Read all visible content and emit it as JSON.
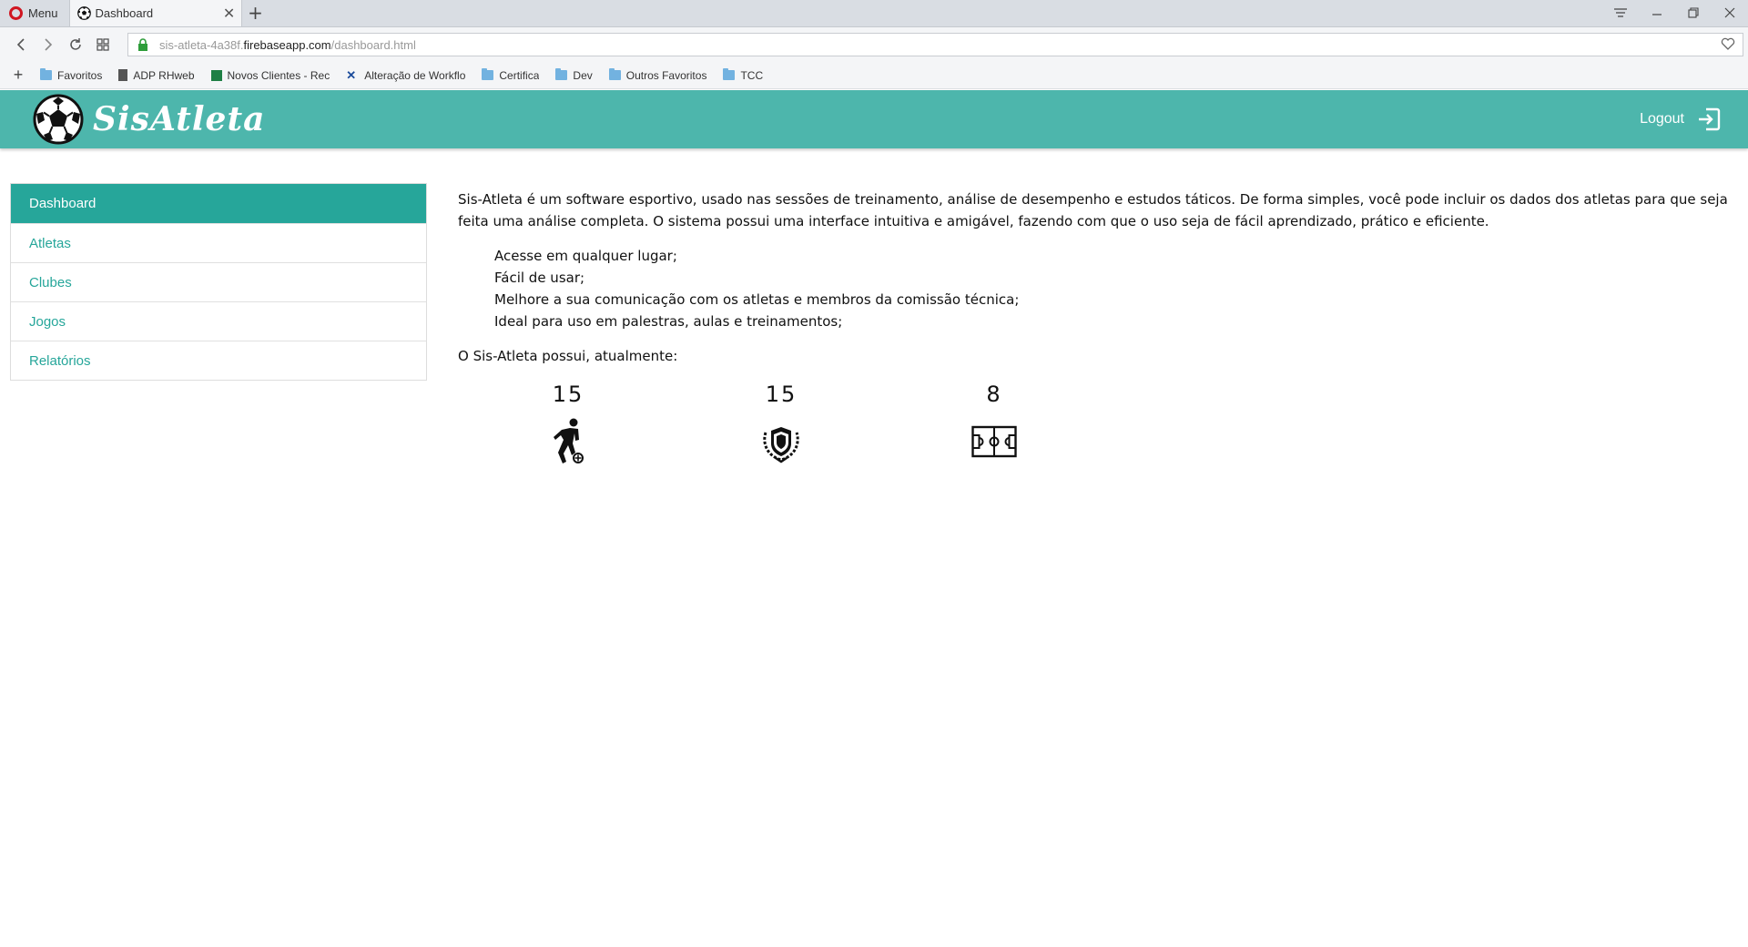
{
  "browser": {
    "menu_label": "Menu",
    "tab_title": "Dashboard",
    "url": {
      "host": "sis-atleta-4a38f.",
      "domain": "firebaseapp.com",
      "path": "/dashboard.html"
    },
    "bookmarks": [
      {
        "label": "Favoritos",
        "icon": "folder-icon"
      },
      {
        "label": "ADP RHweb",
        "icon": "document-icon"
      },
      {
        "label": "Novos Clientes - Rec",
        "icon": "spreadsheet-icon"
      },
      {
        "label": "Alteração de Workflo",
        "icon": "x-icon"
      },
      {
        "label": "Certifica",
        "icon": "folder-icon"
      },
      {
        "label": "Dev",
        "icon": "folder-icon"
      },
      {
        "label": "Outros Favoritos",
        "icon": "folder-icon"
      },
      {
        "label": "TCC",
        "icon": "folder-icon"
      }
    ]
  },
  "header": {
    "brand": "SisAtleta",
    "logout_label": "Logout",
    "color": "#4db6ac"
  },
  "sidebar": {
    "items": [
      {
        "label": "Dashboard",
        "active": true
      },
      {
        "label": "Atletas",
        "active": false
      },
      {
        "label": "Clubes",
        "active": false
      },
      {
        "label": "Jogos",
        "active": false
      },
      {
        "label": "Relatórios",
        "active": false
      }
    ],
    "active_color": "#26a69a"
  },
  "main": {
    "intro": "Sis-Atleta é um software esportivo, usado nas sessões de treinamento, análise de desempenho e estudos táticos. De forma simples, você pode incluir os dados dos atletas para que seja feita uma análise completa. O sistema possui uma interface intuitiva e amigável, fazendo com que o uso seja de fácil aprendizado, prático e eficiente.",
    "features": [
      "Acesse em qualquer lugar;",
      "Fácil de usar;",
      "Melhore a sua comunicação com os atletas e membros da comissão técnica;",
      "Ideal para uso em palestras, aulas e treinamentos;"
    ],
    "stats_caption": "O Sis-Atleta possui, atualmente:",
    "stats": [
      {
        "value": "15",
        "icon": "soccer-player-icon"
      },
      {
        "value": "15",
        "icon": "club-crest-icon"
      },
      {
        "value": "8",
        "icon": "soccer-field-icon"
      }
    ]
  }
}
